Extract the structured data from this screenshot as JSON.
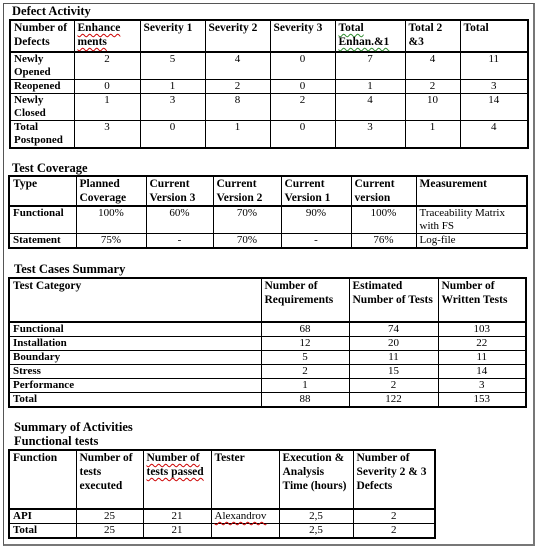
{
  "defect_activity": {
    "title": "Defect Activity",
    "headers": [
      "Number of Defects",
      "Enhance ments",
      "Severity 1",
      "Severity 2",
      "Severity 3",
      "Total Enhan.&1",
      "Total 2 &3",
      "Total"
    ],
    "rows": [
      {
        "label": "Newly Opened",
        "values": [
          "2",
          "5",
          "4",
          "0",
          "7",
          "4",
          "11"
        ]
      },
      {
        "label": "Reopened",
        "values": [
          "0",
          "1",
          "2",
          "0",
          "1",
          "2",
          "3"
        ]
      },
      {
        "label": "Newly Closed",
        "values": [
          "1",
          "3",
          "8",
          "2",
          "4",
          "10",
          "14"
        ]
      },
      {
        "label": "Total Postponed",
        "values": [
          "3",
          "0",
          "1",
          "0",
          "3",
          "1",
          "4"
        ]
      }
    ]
  },
  "test_coverage": {
    "title": "Test Coverage",
    "headers": [
      "Type",
      "Planned Coverage",
      "Current Version 3",
      "Current Version 2",
      "Current Version 1",
      "Current version",
      "Measurement"
    ],
    "rows": [
      {
        "label": "Functional",
        "values": [
          "100%",
          "60%",
          "70%",
          "90%",
          "100%"
        ],
        "measurement": "Traceability Matrix with FS"
      },
      {
        "label": "Statement",
        "values": [
          "75%",
          "-",
          "70%",
          "-",
          "76%"
        ],
        "measurement": "Log-file"
      }
    ]
  },
  "test_cases_summary": {
    "title": "Test Cases Summary",
    "headers": [
      "Test Category",
      "Number of Requirements",
      "Estimated Number of Tests",
      "Number of Written Tests"
    ],
    "rows": [
      {
        "label": "Functional",
        "values": [
          "68",
          "74",
          "103"
        ]
      },
      {
        "label": "Installation",
        "values": [
          "12",
          "20",
          "22"
        ]
      },
      {
        "label": "Boundary",
        "values": [
          "5",
          "11",
          "11"
        ]
      },
      {
        "label": "Stress",
        "values": [
          "2",
          "15",
          "14"
        ]
      },
      {
        "label": "Performance",
        "values": [
          "1",
          "2",
          "3"
        ]
      },
      {
        "label": "Total",
        "values": [
          "88",
          "122",
          "153"
        ]
      }
    ]
  },
  "summary_of_activities": {
    "title": "Summary of Activities",
    "subtitle": "Functional tests",
    "headers": [
      "Function",
      "Number of tests executed",
      "Number of tests passed",
      "Tester",
      "Execution & Analysis Time (hours)",
      "Number of Severity 2 & 3 Defects"
    ],
    "rows": [
      {
        "label": "API",
        "executed": "25",
        "passed": "21",
        "tester": "Alexandrov",
        "time": "2,5",
        "defects": "2"
      },
      {
        "label": "Total",
        "executed": "25",
        "passed": "21",
        "tester": "",
        "time": "2,5",
        "defects": "2"
      }
    ]
  }
}
